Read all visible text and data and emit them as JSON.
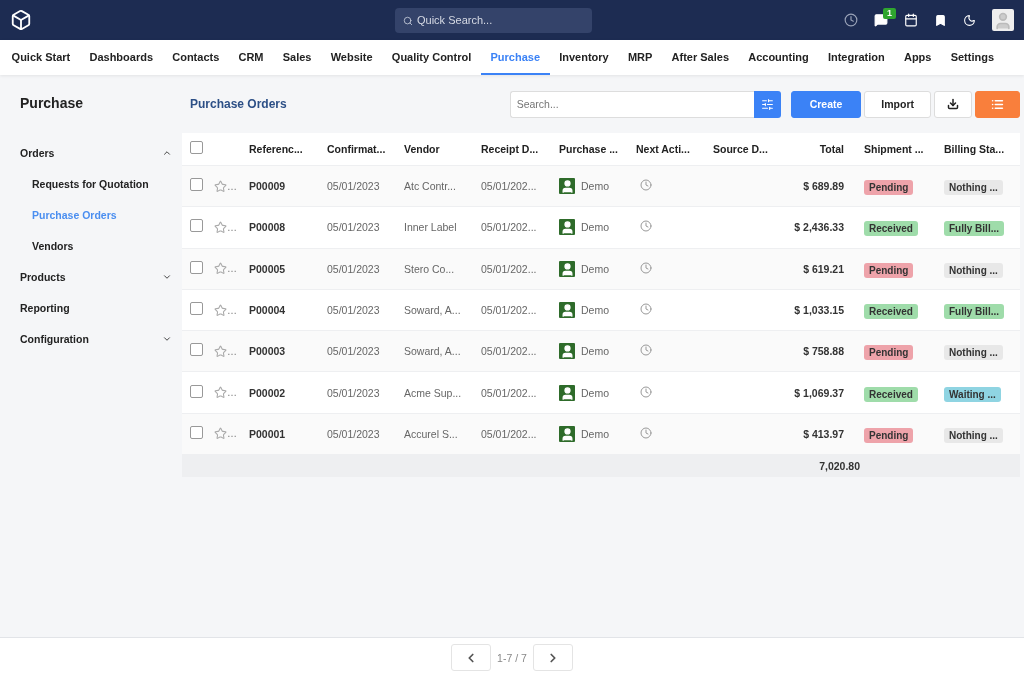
{
  "topbar": {
    "search": {
      "placeholder": "Quick Search..."
    },
    "notifications": "1"
  },
  "menu": [
    {
      "label": "Quick Start",
      "selected": false
    },
    {
      "label": "Dashboards",
      "selected": false
    },
    {
      "label": "Contacts",
      "selected": false
    },
    {
      "label": "CRM",
      "selected": false
    },
    {
      "label": "Sales",
      "selected": false
    },
    {
      "label": "Website",
      "selected": false
    },
    {
      "label": "Quality Control",
      "selected": false
    },
    {
      "label": "Purchase",
      "selected": true
    },
    {
      "label": "Inventory",
      "selected": false
    },
    {
      "label": "MRP",
      "selected": false
    },
    {
      "label": "After Sales",
      "selected": false
    },
    {
      "label": "Accounting",
      "selected": false
    },
    {
      "label": "Integration",
      "selected": false
    },
    {
      "label": "Apps",
      "selected": false
    },
    {
      "label": "Settings",
      "selected": false
    }
  ],
  "sidebar": {
    "title": "Purchase",
    "items": [
      {
        "label": "Orders",
        "expanded": true,
        "selected": false,
        "children": [
          {
            "label": "Requests for Quotation",
            "selected": false
          },
          {
            "label": "Purchase Orders",
            "selected": true
          },
          {
            "label": "Vendors",
            "selected": false
          }
        ]
      },
      {
        "label": "Products",
        "expanded": false,
        "selected": false
      },
      {
        "label": "Reporting",
        "selected": false
      },
      {
        "label": "Configuration",
        "expanded": false,
        "selected": false
      }
    ]
  },
  "breadcrumb": "Purchase Orders",
  "toolbar": {
    "search": {
      "placeholder": "Search..."
    },
    "buttons": [
      {
        "label": "Create",
        "kind": "primary"
      },
      {
        "label": "Import",
        "kind": "plain"
      }
    ]
  },
  "table": {
    "all_checked": false,
    "columns": [
      "Referenc...",
      "Confirmat...",
      "Vendor",
      "Receipt D...",
      "Purchase ...",
      "Next Acti...",
      "Source D...",
      "Total",
      "Shipment ...",
      "Billing Sta..."
    ],
    "rows": [
      {
        "checked": false,
        "star": "…",
        "reference": "P00009",
        "confirmation": "05/01/2023",
        "vendor": "Atc Contr...",
        "receipt": "05/01/202...",
        "purchaser": "Demo",
        "total": "$ 689.89",
        "shipment": {
          "label": "Pending",
          "color": "#eea3aa"
        },
        "billing": {
          "label": "Nothing ...",
          "color": "#e8e8e8"
        }
      },
      {
        "checked": false,
        "star": "…",
        "reference": "P00008",
        "confirmation": "05/01/2023",
        "vendor": "Inner Label",
        "receipt": "05/01/202...",
        "purchaser": "Demo",
        "total": "$ 2,436.33",
        "shipment": {
          "label": "Received",
          "color": "#9fdcaa"
        },
        "billing": {
          "label": "Fully Bill...",
          "color": "#9fdcaa"
        }
      },
      {
        "checked": false,
        "star": "…",
        "reference": "P00005",
        "confirmation": "05/01/2023",
        "vendor": "Stero Co...",
        "receipt": "05/01/202...",
        "purchaser": "Demo",
        "total": "$ 619.21",
        "shipment": {
          "label": "Pending",
          "color": "#eea3aa"
        },
        "billing": {
          "label": "Nothing ...",
          "color": "#e8e8e8"
        }
      },
      {
        "checked": false,
        "star": "…",
        "reference": "P00004",
        "confirmation": "05/01/2023",
        "vendor": "Soward, A...",
        "receipt": "05/01/202...",
        "purchaser": "Demo",
        "total": "$ 1,033.15",
        "shipment": {
          "label": "Received",
          "color": "#9fdcaa"
        },
        "billing": {
          "label": "Fully Bill...",
          "color": "#9fdcaa"
        }
      },
      {
        "checked": false,
        "star": "…",
        "reference": "P00003",
        "confirmation": "05/01/2023",
        "vendor": "Soward, A...",
        "receipt": "05/01/202...",
        "purchaser": "Demo",
        "total": "$ 758.88",
        "shipment": {
          "label": "Pending",
          "color": "#eea3aa"
        },
        "billing": {
          "label": "Nothing ...",
          "color": "#e8e8e8"
        }
      },
      {
        "checked": false,
        "star": "…",
        "reference": "P00002",
        "confirmation": "05/01/2023",
        "vendor": "Acme Sup...",
        "receipt": "05/01/202...",
        "purchaser": "Demo",
        "total": "$ 1,069.37",
        "shipment": {
          "label": "Received",
          "color": "#9fdcaa"
        },
        "billing": {
          "label": "Waiting ...",
          "color": "#8fd4e2"
        }
      },
      {
        "checked": false,
        "star": "…",
        "reference": "P00001",
        "confirmation": "05/01/2023",
        "vendor": "Accurel S...",
        "receipt": "05/01/202...",
        "purchaser": "Demo",
        "total": "$ 413.97",
        "shipment": {
          "label": "Pending",
          "color": "#eea3aa"
        },
        "billing": {
          "label": "Nothing ...",
          "color": "#e8e8e8"
        }
      }
    ],
    "sum": "7,020.80"
  },
  "pager": "1-7 / 7"
}
